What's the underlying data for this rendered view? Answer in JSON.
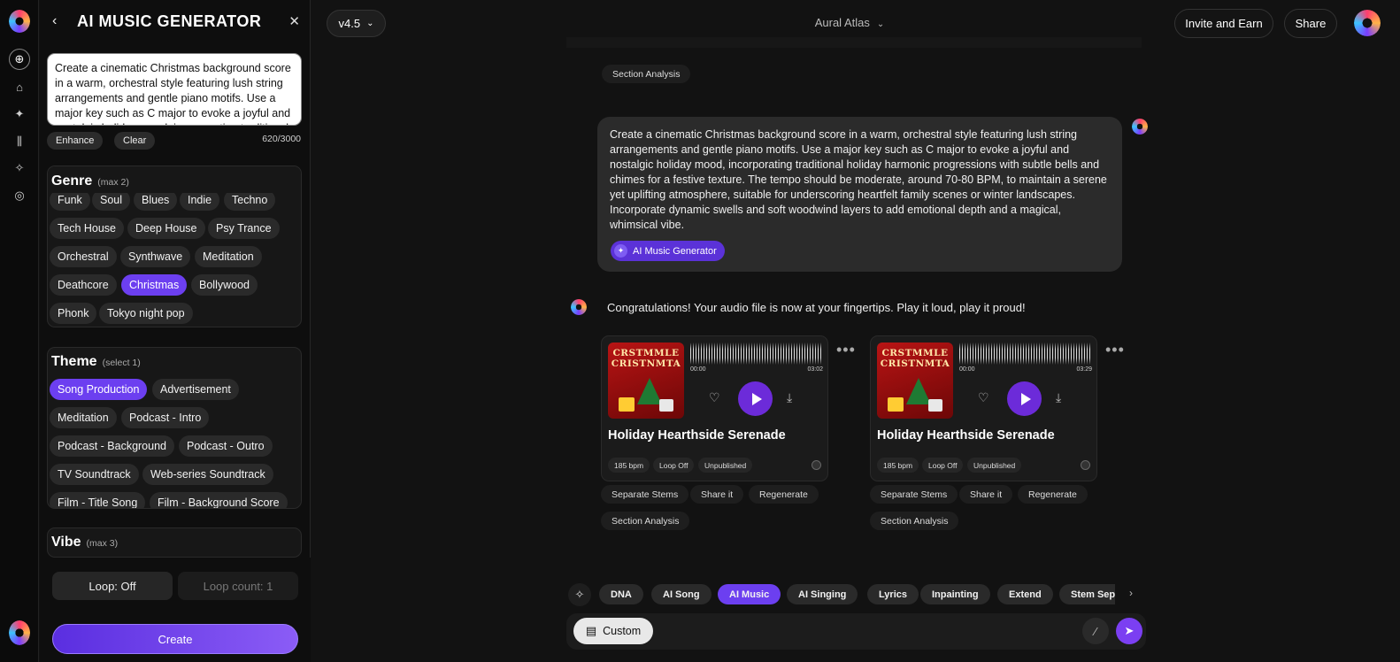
{
  "app": {
    "title": "AI MUSIC GENERATOR",
    "version": "v4.5",
    "workspace": "Aural Atlas",
    "invite_label": "Invite and Earn",
    "share_label": "Share",
    "accent": "#6c3ff0"
  },
  "prompt": {
    "text": "Create a cinematic Christmas background score in a warm, orchestral style featuring lush string arrangements and gentle piano motifs. Use a major key such as C major to evoke a joyful and nostalgic holiday mood, incorporating traditional holiday harmonic progressions with subtle bells",
    "enhance_label": "Enhance",
    "clear_label": "Clear",
    "count": "620/3000"
  },
  "genre": {
    "title": "Genre",
    "sub": "(max 2)",
    "rows": [
      [
        "Funk",
        "Soul",
        "Blues",
        "Indie",
        "Techno"
      ],
      [
        "Tech House",
        "Deep House",
        "Psy Trance"
      ],
      [
        "Orchestral",
        "Synthwave",
        "Meditation"
      ],
      [
        "Deathcore",
        "Christmas",
        "Bollywood"
      ],
      [
        "Phonk",
        "Tokyo night pop"
      ]
    ],
    "selected": "Christmas"
  },
  "theme": {
    "title": "Theme",
    "sub": "(select 1)",
    "rows": [
      [
        "Song Production",
        "Advertisement"
      ],
      [
        "Meditation",
        "Podcast - Intro"
      ],
      [
        "Podcast - Background",
        "Podcast - Outro"
      ],
      [
        "TV Soundtrack",
        "Web-series Soundtrack"
      ],
      [
        "Film - Title Song",
        "Film - Background Score"
      ]
    ],
    "selected": "Song Production"
  },
  "vibe": {
    "title": "Vibe",
    "sub": "(max 3)"
  },
  "loop": {
    "loop_label": "Loop: Off",
    "count_label": "Loop count: 1"
  },
  "create_label": "Create",
  "chat": {
    "top_tag": "Section Analysis",
    "user_message": "Create a cinematic Christmas background score in a warm, orchestral style featuring lush string arrangements and gentle piano motifs. Use a major key such as C major to evoke a joyful and nostalgic holiday mood, incorporating traditional holiday harmonic progressions with subtle bells and chimes for a festive texture. The tempo should be moderate, around 70-80 BPM, to maintain a serene yet uplifting atmosphere, suitable for underscoring heartfelt family scenes or winter landscapes. Incorporate dynamic swells and soft woodwind layers to add emotional depth and a magical, whimsical vibe.",
    "badge": "AI Music Generator",
    "reply": "Congratulations! Your audio file is now at your fingertips. Play it loud, play it proud!",
    "tracks": [
      {
        "cover_text": "CRSTMMLE CRISTNMTA",
        "start": "00:00",
        "end": "03:02",
        "title": "Holiday Hearthside Serenade",
        "bpm": "185 bpm",
        "loop": "Loop Off",
        "status": "Unpublished",
        "actions": [
          "Separate Stems",
          "Share it",
          "Regenerate",
          "Section Analysis"
        ]
      },
      {
        "cover_text": "CRSTMMLE CRISTNMTA",
        "start": "00:00",
        "end": "03:29",
        "title": "Holiday Hearthside Serenade",
        "bpm": "185 bpm",
        "loop": "Loop Off",
        "status": "Unpublished",
        "actions": [
          "Separate Stems",
          "Share it",
          "Regenerate",
          "Section Analysis"
        ]
      }
    ]
  },
  "tools": [
    "DNA",
    "AI Song",
    "AI Music",
    "AI Singing",
    "Lyrics",
    "Inpainting",
    "Extend",
    "Stem Sep"
  ],
  "tools_selected": "AI Music",
  "composer": {
    "custom_label": "Custom"
  }
}
